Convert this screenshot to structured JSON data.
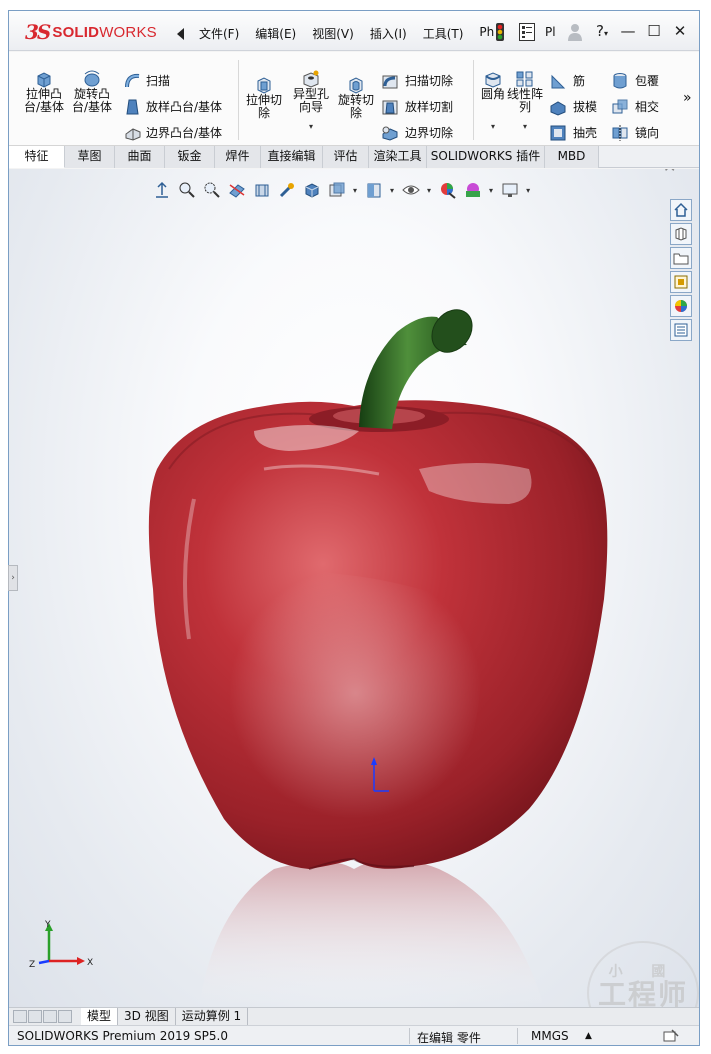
{
  "app": {
    "logo_ds": "3S",
    "logo_solid": "SOLID",
    "logo_works": "WORKS",
    "menus": [
      "文件(F)",
      "编辑(E)",
      "视图(V)",
      "插入(I)",
      "工具(T)",
      "Ph"
    ],
    "menu_more": "Pl",
    "window_controls": [
      "?",
      "—",
      "☐",
      "✕"
    ]
  },
  "ribbon": {
    "extrude_boss": [
      "拉伸凸",
      "台/基体"
    ],
    "revolve_boss": [
      "旋转凸",
      "台/基体"
    ],
    "sweep": "扫描",
    "loft_boss": "放样凸台/基体",
    "boundary_boss": "边界凸台/基体",
    "extrude_cut": [
      "拉伸切",
      "除"
    ],
    "hole_wizard": [
      "异型孔",
      "向导"
    ],
    "revolve_cut": [
      "旋转切",
      "除"
    ],
    "swept_cut": "扫描切除",
    "lofted_cut": "放样切割",
    "boundary_cut": "边界切除",
    "fillet": "圆角",
    "linear_pattern": [
      "线性阵",
      "列"
    ],
    "rib": "筋",
    "draft": "拔模",
    "shell": "抽壳",
    "wrap": "包覆",
    "intersect": "相交",
    "mirror": "镜向",
    "more": "»"
  },
  "tabs": [
    {
      "label": "特征",
      "active": true
    },
    {
      "label": "草图",
      "active": false
    },
    {
      "label": "曲面",
      "active": false
    },
    {
      "label": "钣金",
      "active": false
    },
    {
      "label": "焊件",
      "active": false
    },
    {
      "label": "直接编辑",
      "active": false
    },
    {
      "label": "评估",
      "active": false
    },
    {
      "label": "渲染工具",
      "active": false
    },
    {
      "label": "SOLIDWORKS 插件",
      "active": false
    },
    {
      "label": "MBD",
      "active": false
    }
  ],
  "viewport": {
    "close": "✕",
    "triad_x": "X",
    "triad_y": "Y",
    "triad_z": "Z"
  },
  "bottom_tabs": [
    "模型",
    "3D 视图",
    "运动算例 1"
  ],
  "status": {
    "product": "SOLIDWORKS Premium 2019 SP5.0",
    "mode": "在编辑 零件",
    "units": "MMGS",
    "units_arrow": "▲"
  },
  "watermark": {
    "top": "小 國",
    "main": "工程师"
  },
  "colors": {
    "brand_red": "#d8282f",
    "apple_red": "#b3212b",
    "stem_green": "#2f6b22"
  }
}
